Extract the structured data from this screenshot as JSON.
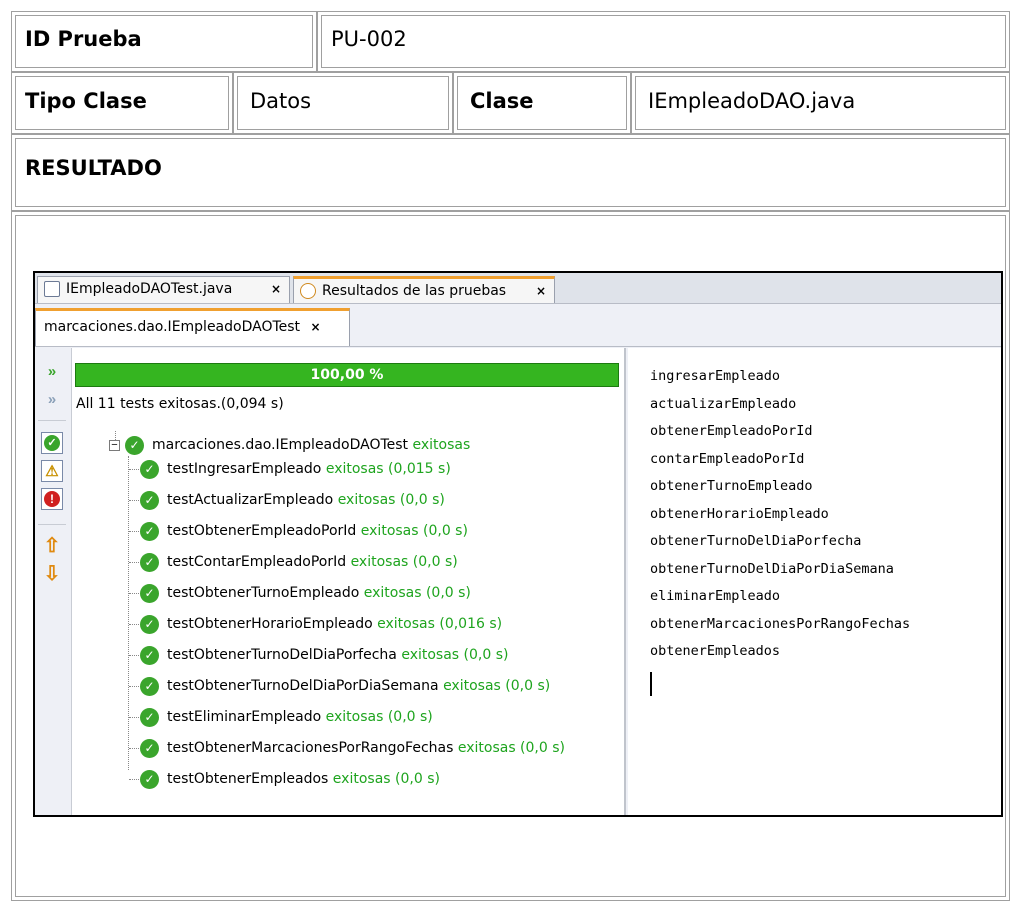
{
  "table": {
    "id_label": "ID Prueba",
    "id_value": "PU-002",
    "tipo_label": "Tipo Clase",
    "tipo_value": "Datos",
    "clase_label": "Clase",
    "clase_value": "IEmpleadoDAO.java",
    "resultado_label": "RESULTADO"
  },
  "ide": {
    "tabs": [
      "IEmpleadoDAOTest.java",
      "Resultados de las pruebas"
    ],
    "subtab": "marcaciones.dao.IEmpleadoDAOTest",
    "close_glyph": "×",
    "progress_text": "100,00 %",
    "progress_value": 1.0,
    "summary": "All 11 tests exitosas.(0,094 s)",
    "root_label": "marcaciones.dao.IEmpleadoDAOTest",
    "root_status": "exitosas",
    "tests": [
      {
        "name": "testIngresarEmpleado",
        "status": "exitosas (0,015 s)"
      },
      {
        "name": "testActualizarEmpleado",
        "status": "exitosas (0,0 s)"
      },
      {
        "name": "testObtenerEmpleadoPorId",
        "status": "exitosas (0,0 s)"
      },
      {
        "name": "testContarEmpleadoPorId",
        "status": "exitosas (0,0 s)"
      },
      {
        "name": "testObtenerTurnoEmpleado",
        "status": "exitosas (0,0 s)"
      },
      {
        "name": "testObtenerHorarioEmpleado",
        "status": "exitosas (0,016 s)"
      },
      {
        "name": "testObtenerTurnoDelDiaPorfecha",
        "status": "exitosas (0,0 s)"
      },
      {
        "name": "testObtenerTurnoDelDiaPorDiaSemana",
        "status": "exitosas (0,0 s)"
      },
      {
        "name": "testEliminarEmpleado",
        "status": "exitosas (0,0 s)"
      },
      {
        "name": "testObtenerMarcacionesPorRangoFechas",
        "status": "exitosas (0,0 s)"
      },
      {
        "name": "testObtenerEmpleados",
        "status": "exitosas (0,0 s)"
      }
    ],
    "output": [
      "ingresarEmpleado",
      "actualizarEmpleado",
      "obtenerEmpleadoPorId",
      "contarEmpleadoPorId",
      "obtenerTurnoEmpleado",
      "obtenerHorarioEmpleado",
      "obtenerTurnoDelDiaPorfecha",
      "obtenerTurnoDelDiaPorDiaSemana",
      "eliminarEmpleado",
      "obtenerMarcacionesPorRangoFechas",
      "obtenerEmpleados"
    ],
    "colors": {
      "progress": "#35b520",
      "status_green": "#1ea41e",
      "tab_accent": "#f0a030"
    }
  }
}
